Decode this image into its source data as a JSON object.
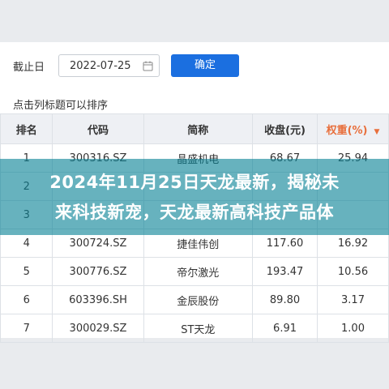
{
  "toolbar": {
    "date_label": "截止日",
    "date_value": "2022-07-25",
    "confirm_label": "确定"
  },
  "hint": "点击列标题可以排序",
  "table": {
    "headers": [
      "排名",
      "代码",
      "简称",
      "收盘(元)",
      "权重(%)"
    ],
    "rows": [
      [
        "1",
        "300316.SZ",
        "晶盛机电",
        "68.67",
        "25.94"
      ],
      [
        "2",
        "",
        "",
        "",
        ""
      ],
      [
        "3",
        "",
        "",
        "",
        ""
      ],
      [
        "4",
        "300724.SZ",
        "捷佳伟创",
        "117.60",
        "16.92"
      ],
      [
        "5",
        "300776.SZ",
        "帝尔激光",
        "193.47",
        "10.56"
      ],
      [
        "6",
        "603396.SH",
        "金辰股份",
        "89.80",
        "3.17"
      ],
      [
        "7",
        "300029.SZ",
        "ST天龙",
        "6.91",
        "1.00"
      ]
    ]
  },
  "banner": {
    "line1": "2024年11月25日天龙最新，揭秘未",
    "line2": "来科技新宠，天龙最新高科技产品体"
  },
  "colors": {
    "accent": "#1b6fe0",
    "sorted_header": "#e86f3c",
    "banner": "#0a8296"
  }
}
